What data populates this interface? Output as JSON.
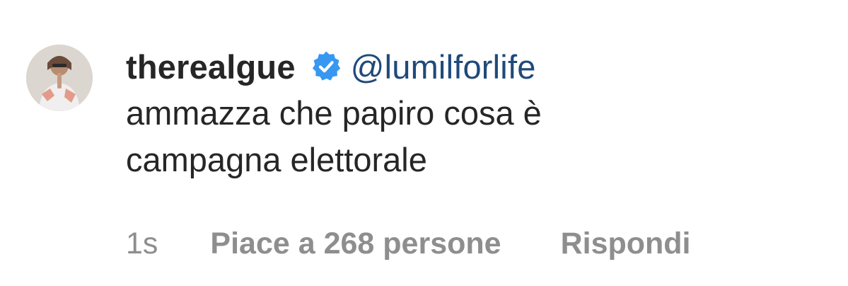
{
  "comment": {
    "username": "therealgue",
    "verified": true,
    "mention": "@lumilforlife",
    "text_lines": [
      "ammazza che papiro cosa è",
      "campagna elettorale"
    ],
    "timestamp": "1s",
    "likes_text": "Piace a 268 persone",
    "reply_label": "Rispondi",
    "icons": {
      "avatar": "profile-photo",
      "verified": "verified-badge-icon"
    },
    "colors": {
      "username": "#262626",
      "mention": "#1f4a7a",
      "meta": "#8e8e8e",
      "badge": "#3897f0"
    }
  }
}
